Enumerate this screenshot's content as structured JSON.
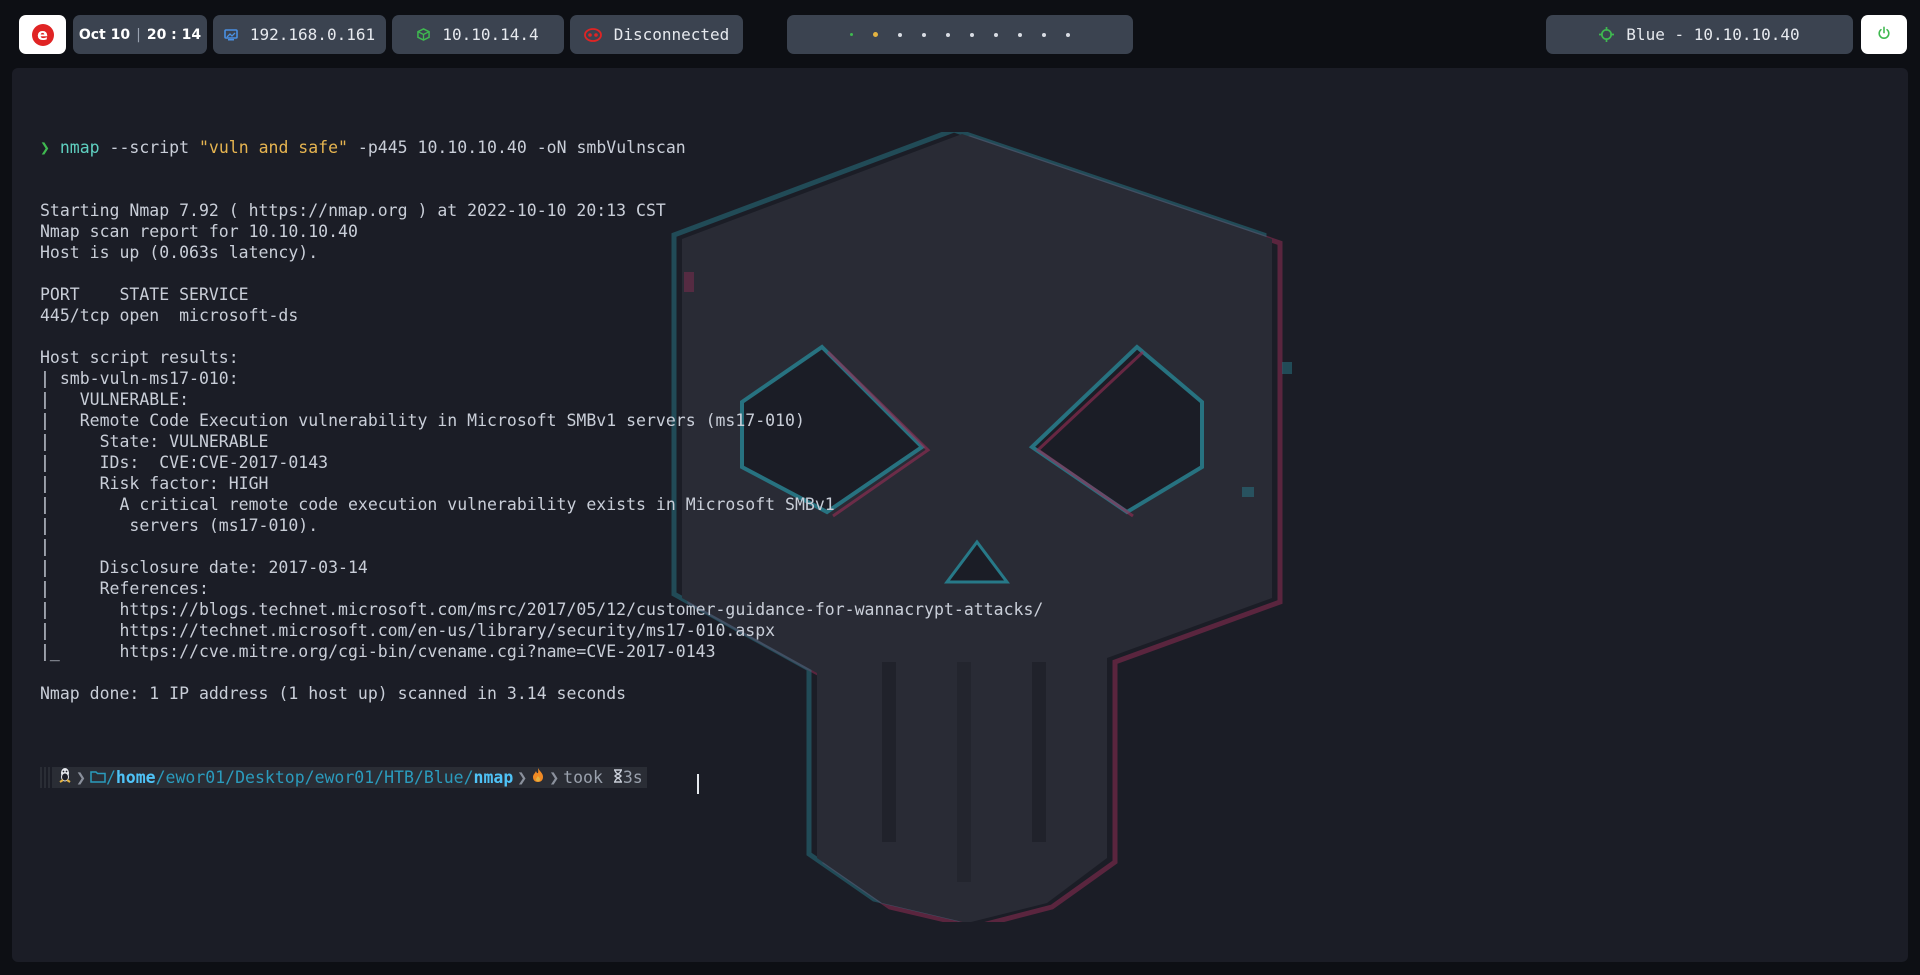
{
  "topbar": {
    "logo_letter": "e",
    "date": "Oct 10",
    "time": "20 : 14",
    "local_ip": "192.168.0.161",
    "vpn_ip": "10.10.14.4",
    "status": "Disconnected",
    "workspaces_count": 10,
    "target": "Blue - 10.10.10.40",
    "colors": {
      "bar_bg": "#3b4350",
      "logo_red": "#e02424",
      "ip_blue": "#4a90e2",
      "vpn_green": "#3fb950",
      "status_red": "#e02424",
      "power_green": "#3fb950"
    }
  },
  "terminal": {
    "command": {
      "arrow": "❯",
      "name": "nmap",
      "args1": " --script ",
      "quoted": "\"vuln and safe\"",
      "args2": " -p445 10.10.10.40 -oN smbVulnscan"
    },
    "output_lines": [
      "Starting Nmap 7.92 ( https://nmap.org ) at 2022-10-10 20:13 CST",
      "Nmap scan report for 10.10.10.40",
      "Host is up (0.063s latency).",
      "",
      "PORT    STATE SERVICE",
      "445/tcp open  microsoft-ds",
      "",
      "Host script results:",
      "| smb-vuln-ms17-010:",
      "|   VULNERABLE:",
      "|   Remote Code Execution vulnerability in Microsoft SMBv1 servers (ms17-010)",
      "|     State: VULNERABLE",
      "|     IDs:  CVE:CVE-2017-0143",
      "|     Risk factor: HIGH",
      "|       A critical remote code execution vulnerability exists in Microsoft SMBv1",
      "|        servers (ms17-010).",
      "|",
      "|     Disclosure date: 2017-03-14",
      "|     References:",
      "|       https://blogs.technet.microsoft.com/msrc/2017/05/12/customer-guidance-for-wannacrypt-attacks/",
      "|       https://technet.microsoft.com/en-us/library/security/ms17-010.aspx",
      "|_      https://cve.mitre.org/cgi-bin/cvename.cgi?name=CVE-2017-0143",
      "",
      "Nmap done: 1 IP address (1 host up) scanned in 3.14 seconds",
      ""
    ],
    "prompt": {
      "os_icon": "linux-tux-icon",
      "dir_prefix": "/home/ewor01/Desktop/ewor01/HTB/Blue/",
      "dir_last": "nmap",
      "flame_icon": "flame-icon",
      "took_label": "took",
      "hourglass_icon": "hourglass-icon",
      "duration": "3s",
      "dir_head": "/home",
      "dir_rest": "/ewor01/Desktop/ewor01/HTB/Blue/"
    }
  }
}
